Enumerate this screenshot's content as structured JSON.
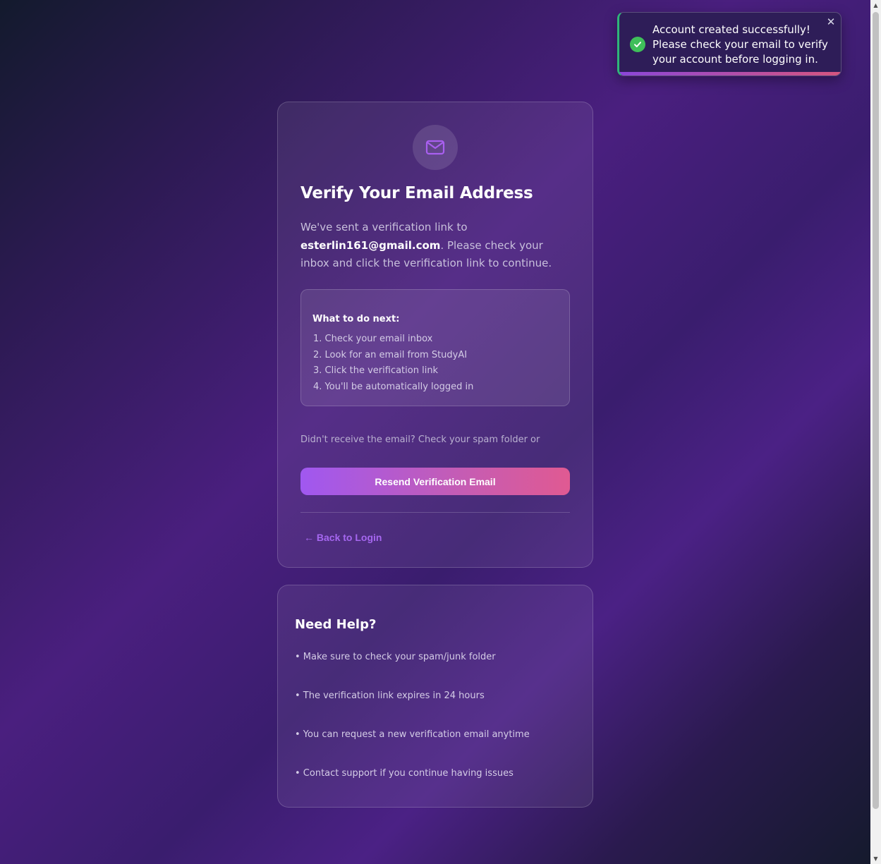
{
  "toast": {
    "message": "Account created successfully! Please check your email to verify your account before logging in.",
    "close_symbol": "✕",
    "icon": "check-circle-icon",
    "accent_color": "#2fb67a"
  },
  "card": {
    "icon": "mail-icon",
    "title": "Verify Your Email Address",
    "desc_before": "We've sent a verification link to",
    "email": "esterlin161@gmail.com",
    "desc_after": ". Please check your inbox and click the verification link to continue.",
    "next_title": "What to do next:",
    "next_steps": [
      "1. Check your email inbox",
      "2. Look for an email from StudyAI",
      "3. Click the verification link",
      "4. You'll be automatically logged in"
    ],
    "didnt_receive": "Didn't receive the email? Check your spam folder or",
    "resend_label": "Resend Verification Email",
    "back_label": "← Back to Login"
  },
  "help": {
    "title": "Need Help?",
    "items": [
      "• Make sure to check your spam/junk folder",
      "• The verification link expires in 24 hours",
      "• You can request a new verification email anytime",
      "• Contact support if you continue having issues"
    ]
  },
  "colors": {
    "accent_purple": "#a667f0",
    "button_gradient_start": "#a058f0",
    "button_gradient_end": "#e05a92"
  }
}
